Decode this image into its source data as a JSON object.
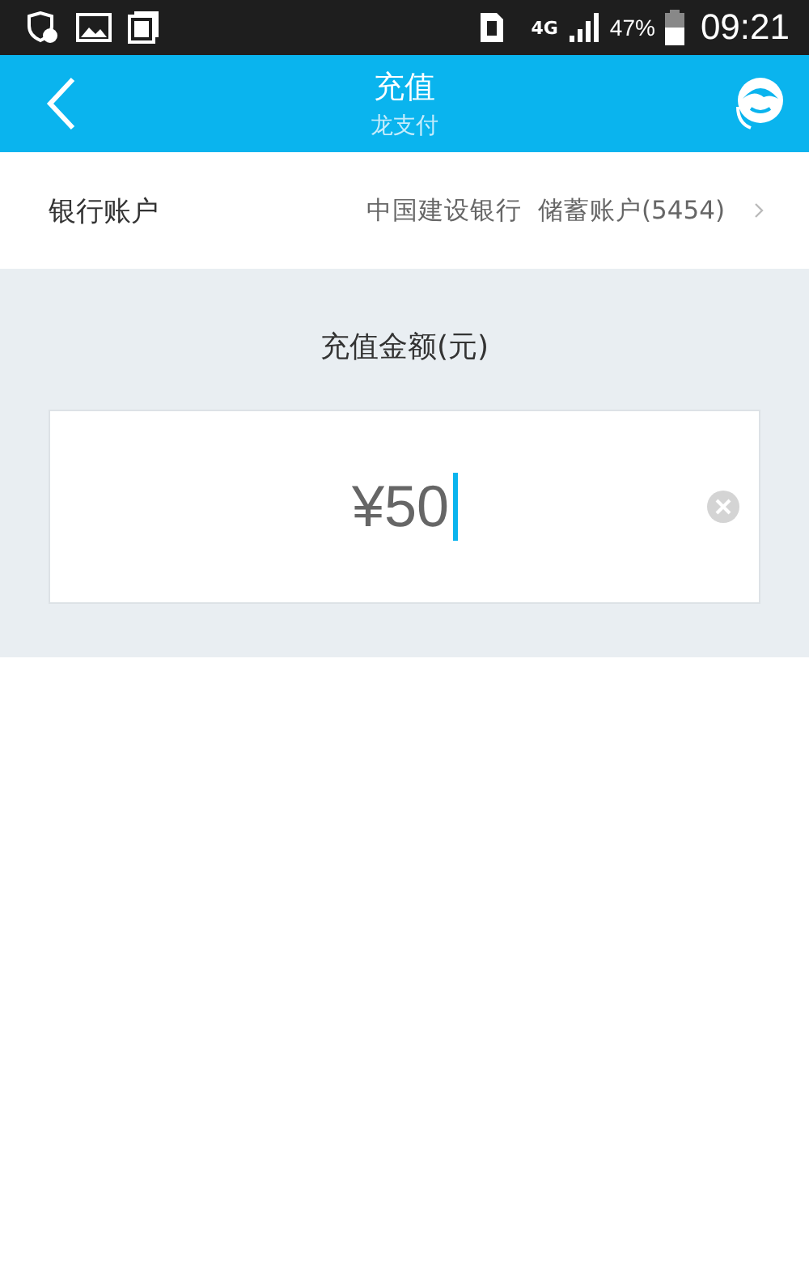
{
  "status_bar": {
    "network": "4G",
    "battery": "47%",
    "time": "09:21"
  },
  "header": {
    "title": "充值",
    "subtitle": "龙支付"
  },
  "bank_account": {
    "label": "银行账户",
    "value": "中国建设银行  储蓄账户(5454)"
  },
  "amount": {
    "title": "充值金额(元)",
    "value": "¥50"
  }
}
